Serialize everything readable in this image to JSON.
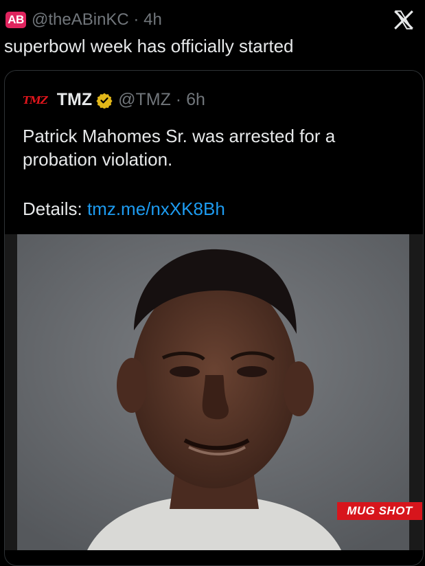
{
  "tweet": {
    "avatar_text": "AB",
    "handle": "@theABinKC",
    "time": "4h",
    "text": "superbowl week has officially started"
  },
  "quoted": {
    "logo_text": "TMZ",
    "name": "TMZ",
    "handle": "@TMZ",
    "time": "6h",
    "text": "Patrick Mahomes Sr. was arrested for a probation violation.",
    "details_label": "Details:",
    "link": "tmz.me/nxXK8Bh",
    "image_badge": "MUG SHOT"
  },
  "icons": {
    "brand": "x-logo-icon",
    "verified": "verified-badge-icon"
  },
  "colors": {
    "link": "#1d9bf0",
    "muted": "#71767b",
    "badge_red": "#d7151c",
    "avatar_bg": "#e0245e",
    "verified_gold": "#e2b719"
  }
}
